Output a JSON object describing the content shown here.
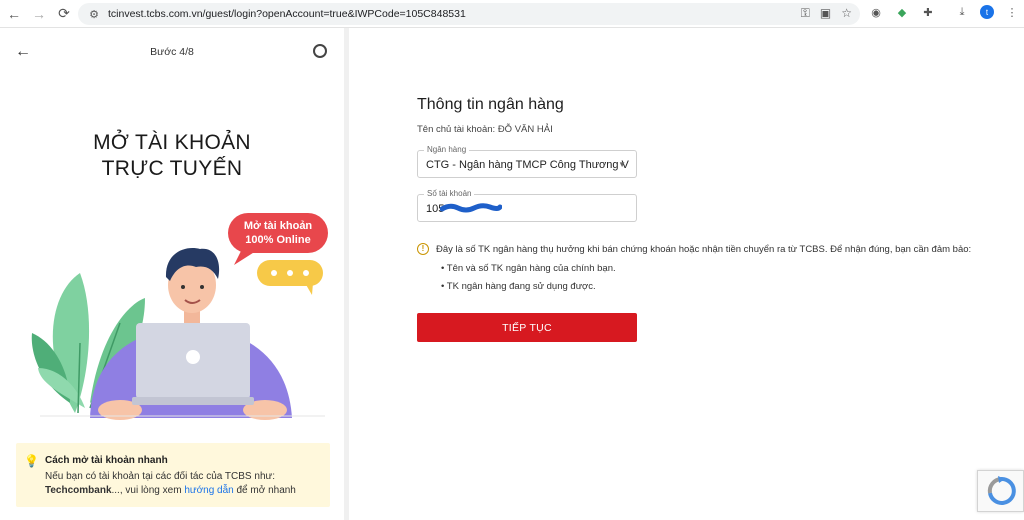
{
  "browser": {
    "url": "tcinvest.tcbs.com.vn/guest/login?openAccount=true&IWPCode=105C848531",
    "profile_initial": "t"
  },
  "left_panel": {
    "step": "Bước 4/8",
    "hero_title_line1": "MỞ TÀI KHOẢN",
    "hero_title_line2": "TRỰC TUYẾN",
    "bubble_line1": "Mở tài khoản",
    "bubble_line2": "100% Online",
    "tip": {
      "title": "Cách mở tài khoản nhanh",
      "body_part1": "Nếu bạn có tài khoản tại các đối tác của TCBS như: ",
      "body_bold": "Techcombank",
      "body_part2": "..., vui lòng xem ",
      "link": "hướng dẫn",
      "body_part3": " để mở nhanh"
    }
  },
  "form": {
    "title": "Thông tin ngân hàng",
    "owner_label": "Tên chủ tài khoản:",
    "owner_name": "ĐỖ VĂN HẢI",
    "bank_label": "Ngân hàng",
    "bank_value": "CTG - Ngân hàng TMCP Công Thương V",
    "account_label": "Số tài khoản",
    "account_value": "105",
    "notice": "Đây là số TK ngân hàng thụ hưởng khi bán chứng khoán hoặc nhận tiền chuyển ra từ TCBS. Để nhận đúng, bạn cần đảm bảo:",
    "bullets": [
      "Tên và số TK ngân hàng của chính bạn.",
      "TK ngân hàng đang sử dụng được."
    ],
    "submit_label": "TIẾP TỤC"
  },
  "colors": {
    "primary_red": "#d71920",
    "bubble_red": "#e8474c",
    "tip_bg": "#fff8dc",
    "link_blue": "#1a73e8"
  }
}
